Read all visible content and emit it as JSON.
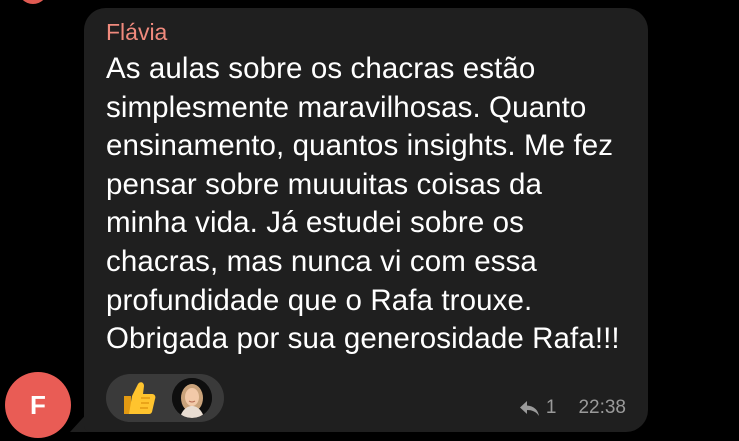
{
  "message": {
    "sender_name": "Flávia",
    "lines": [
      "As aulas sobre os chacras estão",
      "simplesmente maravilhosas. Quanto",
      "ensinamento, quantos insights. Me fez",
      "pensar sobre muuuitas coisas da",
      "minha vida. Já estudei sobre os",
      "chacras, mas nunca vi com essa",
      "profundidade que o Rafa trouxe.",
      "Obrigada por sua generosidade Rafa!!!"
    ],
    "reaction": {
      "emoji_icon": "thumbs-up-icon",
      "reactor": "reactor-photo-avatar"
    },
    "reply_count": "1",
    "time": "22:38"
  },
  "sender_avatar": {
    "initial": "F",
    "color": "#e95c55"
  },
  "colors": {
    "background": "#000000",
    "bubble": "#1f1f1f",
    "sender_name": "#f08a7d",
    "text": "#ffffff",
    "meta": "#9a9a9a",
    "reaction_pill": "#3a3a3a"
  }
}
